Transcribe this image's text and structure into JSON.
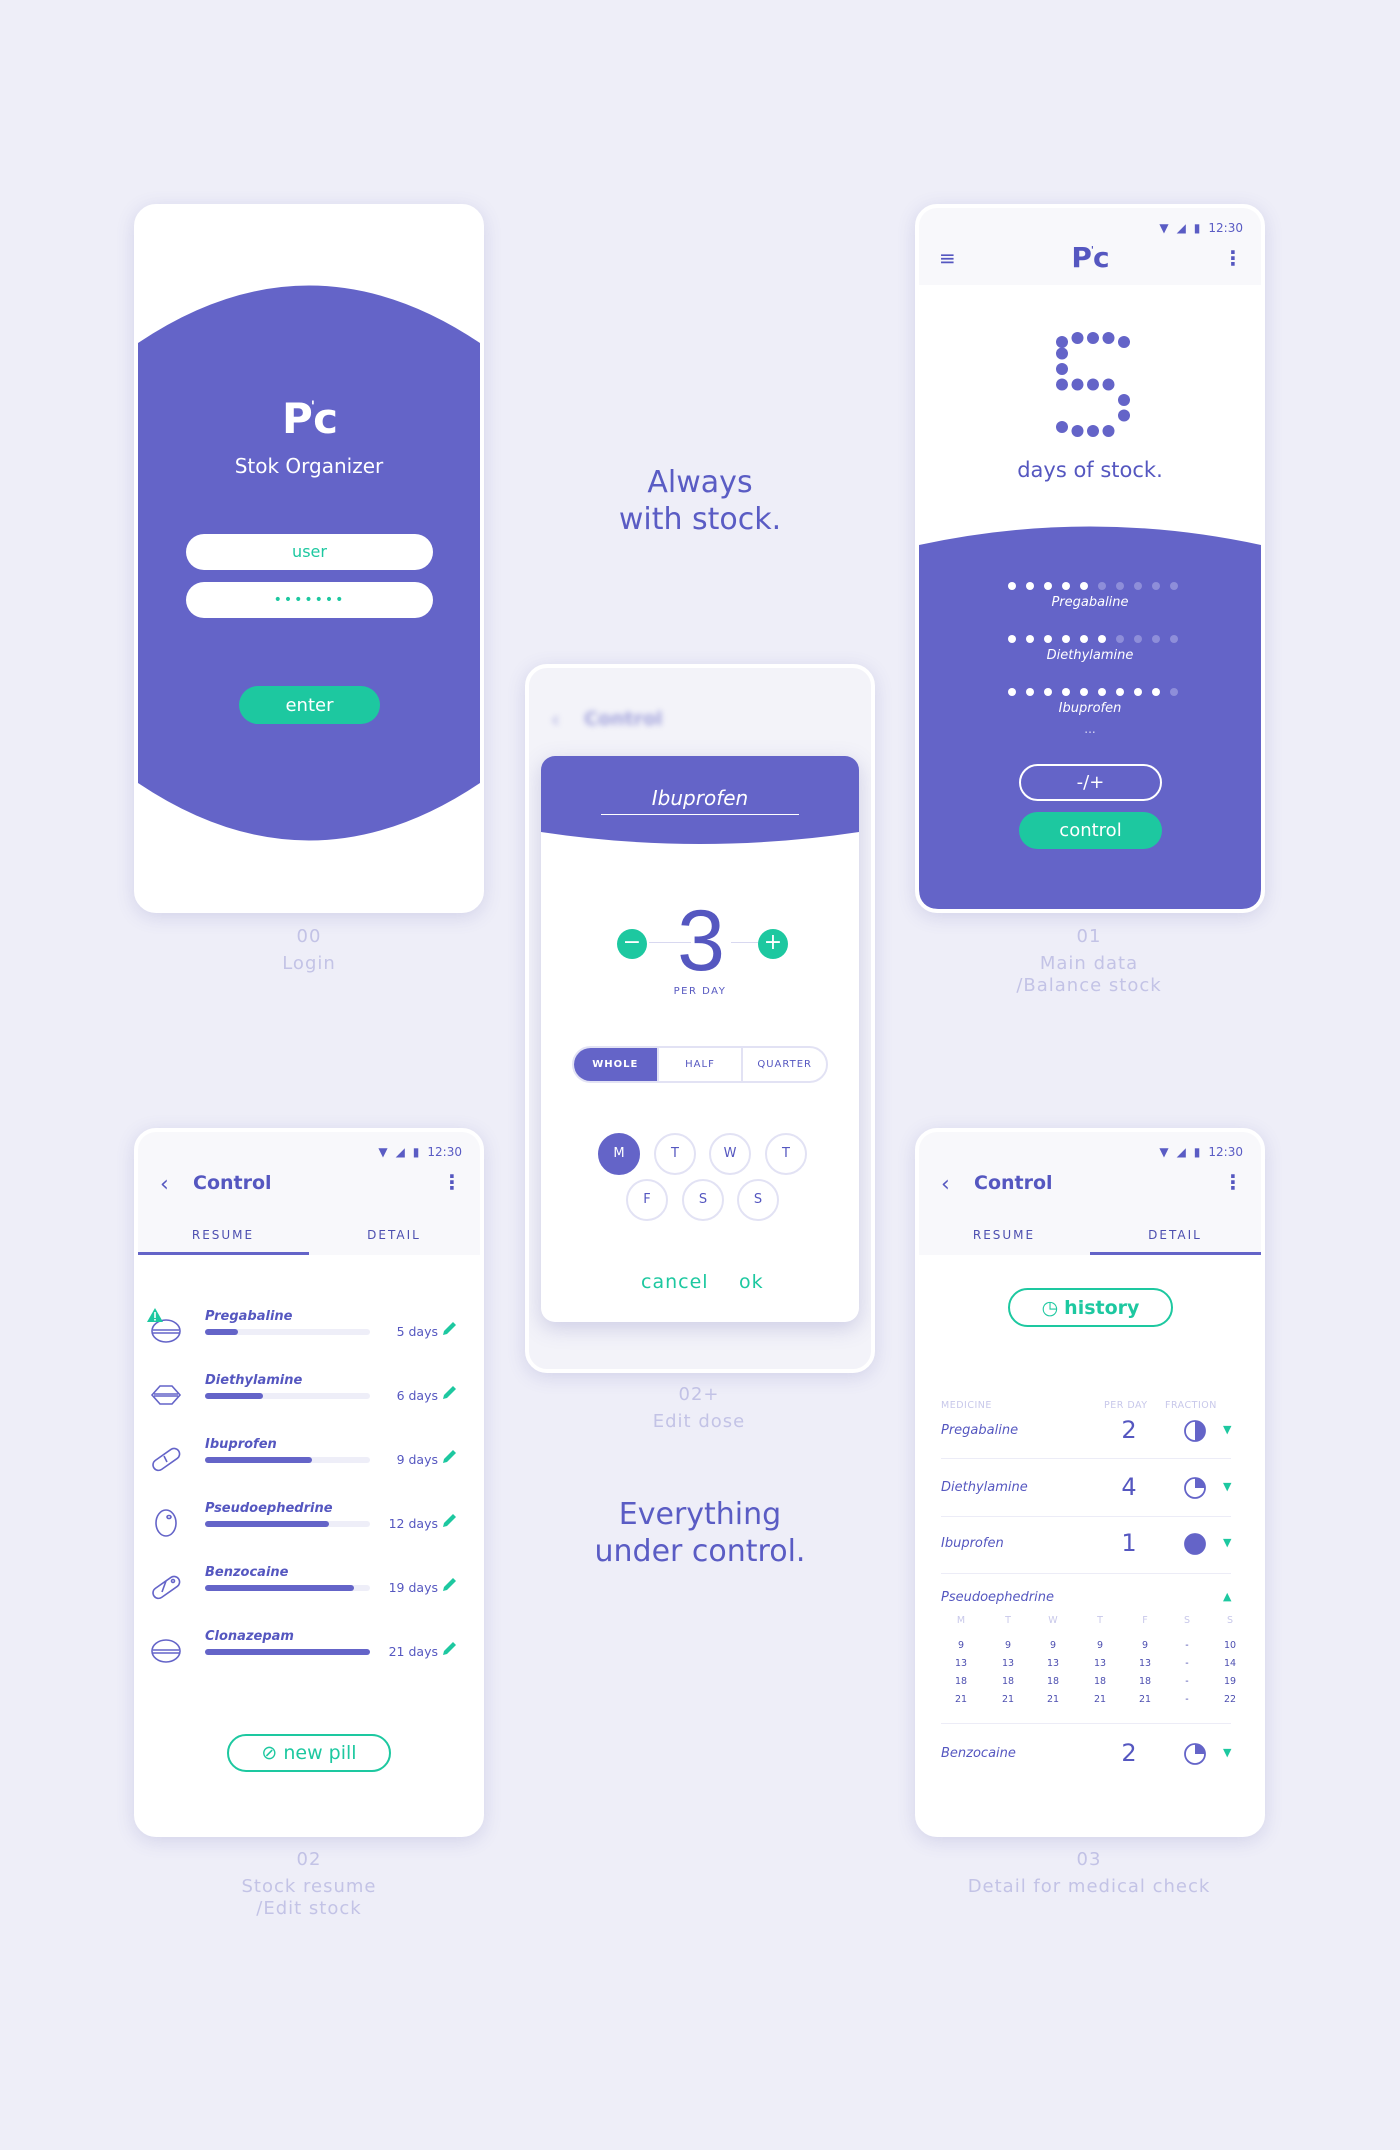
{
  "colors": {
    "primary": "#6464c8",
    "accent": "#1dc8a0",
    "background": "#eeeef8"
  },
  "logo": "Pc",
  "taglines": {
    "top": [
      "Always",
      "with stock."
    ],
    "bottom": [
      "Everything",
      "under control."
    ]
  },
  "captions": {
    "login": {
      "num": "00",
      "text": "Login"
    },
    "main": {
      "num": "01",
      "text": "Main data",
      "text2": "/Balance stock"
    },
    "edit_dose": {
      "num": "02+",
      "text": "Edit dose"
    },
    "stock": {
      "num": "02",
      "text": "Stock resume",
      "text2": "/Edit stock"
    },
    "detail": {
      "num": "03",
      "text": "Detail for medical check"
    }
  },
  "status": {
    "time": "12:30"
  },
  "login": {
    "app_name": "Stok Organizer",
    "user_value": "user",
    "password_value": "•••••••",
    "enter": "enter"
  },
  "main": {
    "days": 5,
    "days_label": "days of stock.",
    "stock": [
      {
        "name": "Pregabaline",
        "filled": 5,
        "total": 10
      },
      {
        "name": "Diethylamine",
        "filled": 6,
        "total": 10
      },
      {
        "name": "Ibuprofen",
        "filled": 9,
        "total": 10
      }
    ],
    "more": "...",
    "adjust": "-/+",
    "control": "control"
  },
  "edit": {
    "bg_title": "Control",
    "medicine": "Ibuprofen",
    "per_day": "3",
    "per_day_label": "PER DAY",
    "fractions": [
      "WHOLE",
      "HALF",
      "QUARTER"
    ],
    "selected_fraction": "WHOLE",
    "days": [
      "M",
      "T",
      "W",
      "T",
      "F",
      "S",
      "S"
    ],
    "selected_days": [
      0
    ],
    "cancel": "cancel",
    "ok": "ok"
  },
  "control": {
    "title": "Control",
    "tabs": [
      "RESUME",
      "DETAIL"
    ]
  },
  "stock": {
    "items": [
      {
        "name": "Pregabaline",
        "days": "5 days",
        "level": 0.2,
        "icon": "round-tablet-icon",
        "warning": true
      },
      {
        "name": "Diethylamine",
        "days": "6 days",
        "level": 0.35,
        "icon": "diamond-tablet-icon"
      },
      {
        "name": "Ibuprofen",
        "days": "9 days",
        "level": 0.65,
        "icon": "capsule-icon"
      },
      {
        "name": "Pseudoephedrine",
        "days": "12 days",
        "level": 0.75,
        "icon": "oval-pill-icon"
      },
      {
        "name": "Benzocaine",
        "days": "19 days",
        "level": 0.9,
        "icon": "two-tone-capsule-icon"
      },
      {
        "name": "Clonazepam",
        "days": "21 days",
        "level": 1.0,
        "icon": "round-tablet-icon"
      }
    ],
    "new_pill": "new pill"
  },
  "detail": {
    "history": "history",
    "headers": [
      "MEDICINE",
      "PER DAY",
      "FRACTION"
    ],
    "rows": [
      {
        "name": "Pregabaline",
        "per_day": "2",
        "fraction": "half"
      },
      {
        "name": "Diethylamine",
        "per_day": "4",
        "fraction": "quarter"
      },
      {
        "name": "Ibuprofen",
        "per_day": "1",
        "fraction": "whole"
      }
    ],
    "expanded": {
      "name": "Pseudoephedrine",
      "days": [
        "M",
        "T",
        "W",
        "T",
        "F",
        "S",
        "S"
      ],
      "schedule": [
        [
          "9",
          "9",
          "9",
          "9",
          "9",
          "-",
          "10"
        ],
        [
          "13",
          "13",
          "13",
          "13",
          "13",
          "-",
          "14"
        ],
        [
          "18",
          "18",
          "18",
          "18",
          "18",
          "-",
          "19"
        ],
        [
          "21",
          "21",
          "21",
          "21",
          "21",
          "-",
          "22"
        ]
      ]
    },
    "last": {
      "name": "Benzocaine",
      "per_day": "2",
      "fraction": "quarter"
    }
  }
}
